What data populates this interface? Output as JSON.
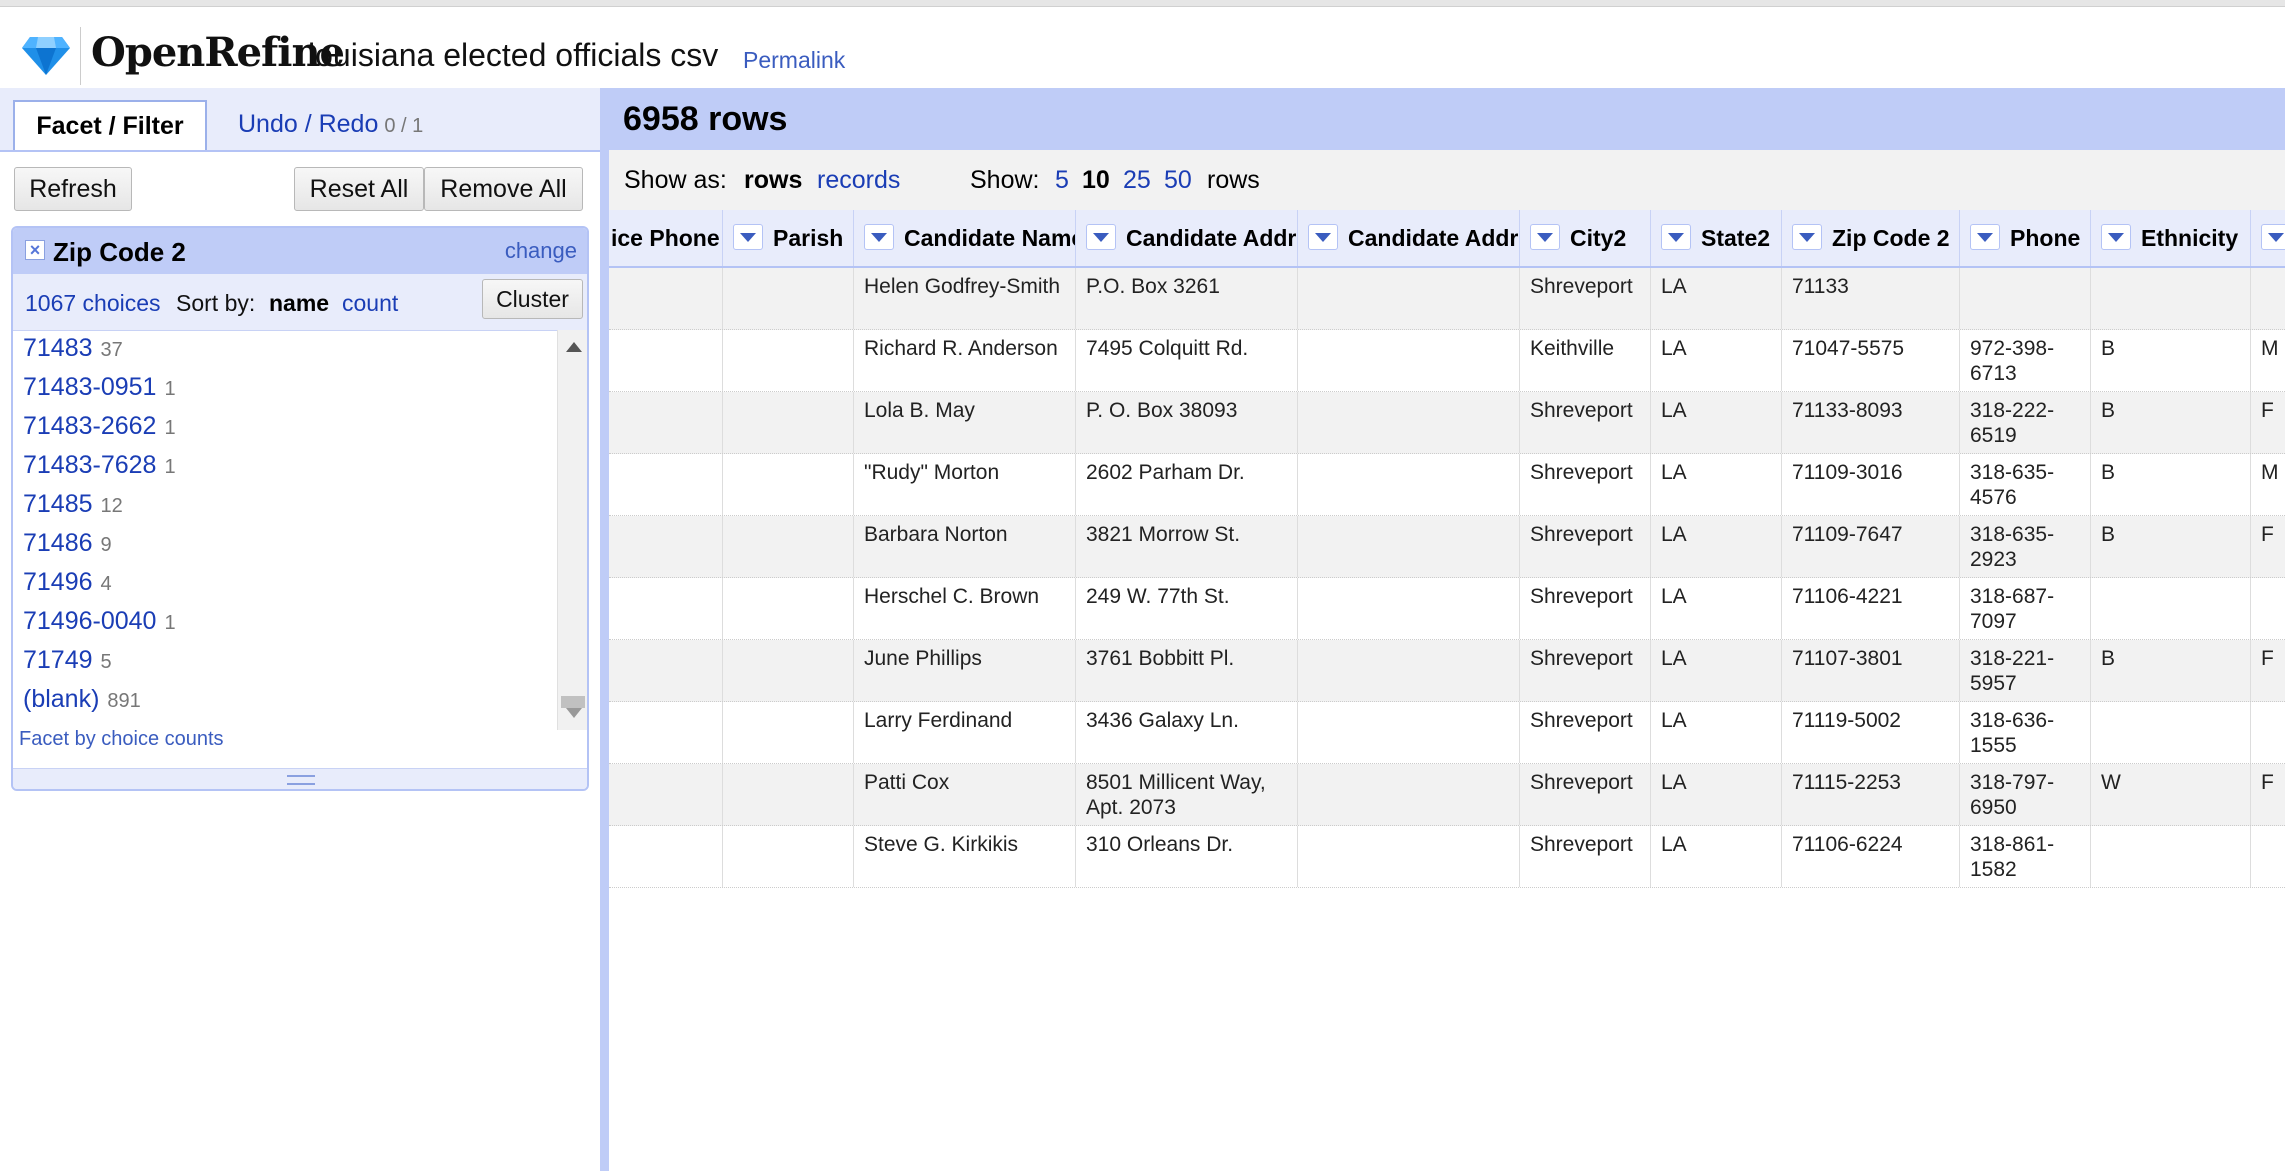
{
  "app": {
    "logo_text": "OpenRefine",
    "project_title": "louisiana elected officials csv",
    "permalink": "Permalink"
  },
  "left": {
    "tab_facet": "Facet / Filter",
    "tab_undo": "Undo / Redo",
    "undo_count": "0 / 1",
    "refresh": "Refresh",
    "reset_all": "Reset All",
    "remove_all": "Remove All"
  },
  "facet": {
    "close": "×",
    "name": "Zip Code 2",
    "change": "change",
    "choices_count": "1067 choices",
    "sort_by": "Sort by:",
    "sort_name": "name",
    "sort_count": "count",
    "cluster": "Cluster",
    "choices": [
      {
        "label": "71483",
        "count": "37"
      },
      {
        "label": "71483-0951",
        "count": "1"
      },
      {
        "label": "71483-2662",
        "count": "1"
      },
      {
        "label": "71483-7628",
        "count": "1"
      },
      {
        "label": "71485",
        "count": "12"
      },
      {
        "label": "71486",
        "count": "9"
      },
      {
        "label": "71496",
        "count": "4"
      },
      {
        "label": "71496-0040",
        "count": "1"
      },
      {
        "label": "71749",
        "count": "5"
      },
      {
        "label": "(blank)",
        "count": "891"
      }
    ],
    "footer": "Facet by choice counts"
  },
  "right": {
    "rows_count": "6958 rows",
    "show_as": "Show as:",
    "rows": "rows",
    "records": "records",
    "show": "Show:",
    "sizes": [
      "5",
      "10",
      "25",
      "50"
    ],
    "active_size": "10",
    "rows_suffix": "rows"
  },
  "table": {
    "columns": [
      "ice Phone",
      "Parish",
      "Candidate Name",
      "Candidate Addre",
      "Candidate Addre",
      "City2",
      "State2",
      "Zip Code 2",
      "Phone",
      "Ethnicity",
      ""
    ],
    "rows": [
      [
        "",
        "",
        "Helen Godfrey-Smith",
        "P.O. Box 3261",
        "",
        "Shreveport",
        "LA",
        "71133",
        "",
        "",
        ""
      ],
      [
        "",
        "",
        "Richard R. Anderson",
        "7495 Colquitt Rd.",
        "",
        "Keithville",
        "LA",
        "71047-5575",
        "972-398-6713",
        "B",
        "M"
      ],
      [
        "",
        "",
        "Lola B. May",
        "P. O. Box 38093",
        "",
        "Shreveport",
        "LA",
        "71133-8093",
        "318-222-6519",
        "B",
        "F"
      ],
      [
        "",
        "",
        "\"Rudy\" Morton",
        "2602 Parham Dr.",
        "",
        "Shreveport",
        "LA",
        "71109-3016",
        "318-635-4576",
        "B",
        "M"
      ],
      [
        "",
        "",
        "Barbara Norton",
        "3821 Morrow St.",
        "",
        "Shreveport",
        "LA",
        "71109-7647",
        "318-635-2923",
        "B",
        "F"
      ],
      [
        "",
        "",
        "Herschel C. Brown",
        "249 W. 77th St.",
        "",
        "Shreveport",
        "LA",
        "71106-4221",
        "318-687-7097",
        "",
        ""
      ],
      [
        "",
        "",
        "June Phillips",
        "3761 Bobbitt Pl.",
        "",
        "Shreveport",
        "LA",
        "71107-3801",
        "318-221-5957",
        "B",
        "F"
      ],
      [
        "",
        "",
        "Larry Ferdinand",
        "3436 Galaxy Ln.",
        "",
        "Shreveport",
        "LA",
        "71119-5002",
        "318-636-1555",
        "",
        ""
      ],
      [
        "",
        "",
        "Patti Cox",
        "8501 Millicent Way, Apt. 2073",
        "",
        "Shreveport",
        "LA",
        "71115-2253",
        "318-797-6950",
        "W",
        "F"
      ],
      [
        "",
        "",
        "Steve G. Kirkikis",
        "310 Orleans Dr.",
        "",
        "Shreveport",
        "LA",
        "71106-6224",
        "318-861-1582",
        "",
        ""
      ]
    ]
  },
  "colors": {
    "accent": "#bfccf7",
    "link": "#1a3db5",
    "tab_bg": "#e8ecfb"
  }
}
